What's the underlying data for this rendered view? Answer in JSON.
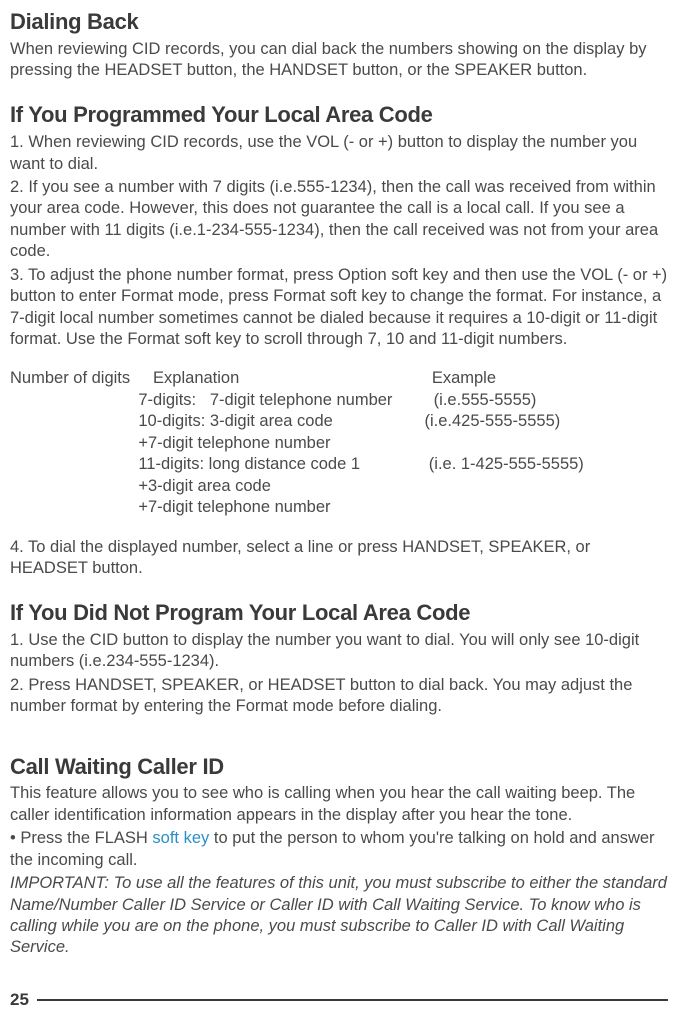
{
  "section1": {
    "heading": "Dialing Back",
    "body": "When reviewing CID records, you can dial back the numbers showing on the display by pressing the HEADSET button, the HANDSET button, or the SPEAKER button."
  },
  "section2": {
    "heading": "If You Programmed Your Local Area Code",
    "step1": "1. When reviewing CID records, use the VOL (- or +) button to display the number you want to dial.",
    "step2": "2. If you see a number with 7 digits (i.e.555-1234), then the call was received from within your area code. However, this does not guarantee the call is a local call. If you see a number with 11 digits (i.e.1-234-555-1234), then the call received was not from your area code.",
    "step3": "3. To adjust the phone number format, press Option soft key and then use the VOL (- or +) button to enter Format mode, press Format soft key to change the format. For instance, a 7-digit local number sometimes cannot be dialed because it requires a 10-digit or 11-digit format. Use the Format soft key to scroll through 7, 10 and 11-digit numbers.",
    "tableHeader": "Number of digits     Explanation                                          Example",
    "row1a": "                            7-digits:   7-digit telephone number         (i.e.555-5555)",
    "row2a": "                            10-digits: 3-digit area code                    (i.e.425-555-5555)",
    "row2b": "                            +7-digit telephone number",
    "row3a": "                            11-digits: long distance code 1               (i.e. 1-425-555-5555)",
    "row3b": "                            +3-digit area code",
    "row3c": "                            +7-digit telephone number",
    "step4": "4. To dial the displayed number, select a line or press HANDSET, SPEAKER, or HEADSET button."
  },
  "section3": {
    "heading": "If You Did Not Program Your Local Area Code",
    "step1": "1. Use the CID button to display the number you want to dial. You will only see 10-digit numbers (i.e.234-555-1234).",
    "step2": "2. Press HANDSET, SPEAKER, or HEADSET button to dial back. You may adjust the number format by entering the Format mode before dialing."
  },
  "section4": {
    "heading": "Call Waiting Caller ID",
    "body1": "This feature allows you to see who is calling when you hear the call waiting beep. The caller identification information appears in the display after you hear the tone.",
    "bullet_pre": "• Press the FLASH ",
    "softkey": "soft key",
    "bullet_post": " to put the person to whom you're talking on hold and answer the incoming call.",
    "important": "IMPORTANT: To use all the features of this unit, you must subscribe to either the standard Name/Number Caller ID Service or Caller ID with Call Waiting Service. To know who is calling while you are on the phone, you must subscribe to Caller ID with Call Waiting Service."
  },
  "pageNumber": "25"
}
